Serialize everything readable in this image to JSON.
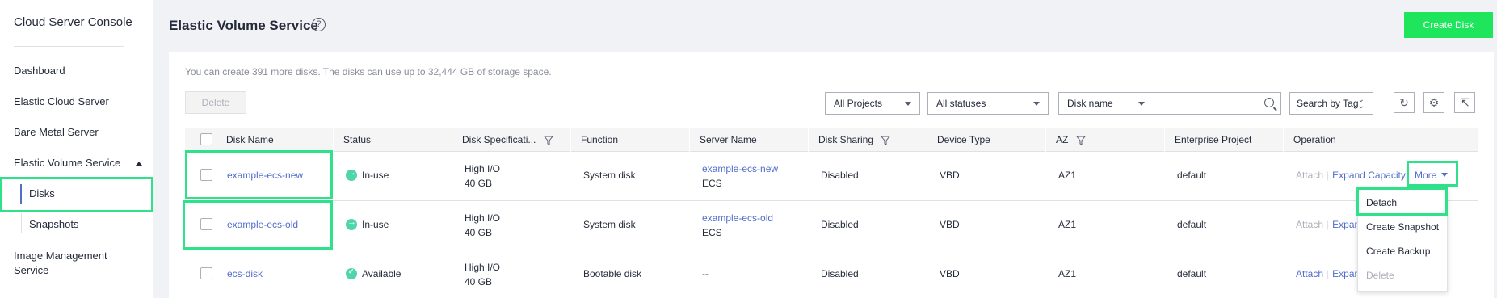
{
  "sidebar": {
    "title": "Cloud Server Console",
    "items": [
      {
        "label": "Dashboard"
      },
      {
        "label": "Elastic Cloud Server"
      },
      {
        "label": "Bare Metal Server"
      },
      {
        "label": "Elastic Volume Service"
      },
      {
        "label": "Disks"
      },
      {
        "label": "Snapshots"
      },
      {
        "label": "Image Management Service"
      }
    ]
  },
  "header": {
    "title": "Elastic Volume Service",
    "help_icon": "?",
    "create_label": "Create Disk"
  },
  "toolbar": {
    "quota_text": "You can create 391 more disks. The disks can use up to 32,444 GB of storage space.",
    "delete_label": "Delete",
    "project_select": "All Projects",
    "status_select": "All statuses",
    "search_field_select": "Disk name",
    "search_placeholder": "",
    "tag_label": "Search by Tag"
  },
  "table": {
    "headers": {
      "disk_name": "Disk Name",
      "status": "Status",
      "spec": "Disk Specificati...",
      "function": "Function",
      "server": "Server Name",
      "sharing": "Disk Sharing",
      "device": "Device Type",
      "az": "AZ",
      "project": "Enterprise Project",
      "operation": "Operation"
    },
    "rows": [
      {
        "name": "example-ecs-new",
        "status": "In-use",
        "spec_type": "High I/O",
        "spec_size": "40 GB",
        "function": "System disk",
        "server_name": "example-ecs-new",
        "server_type": "ECS",
        "sharing": "Disabled",
        "device": "VBD",
        "az": "AZ1",
        "project": "default",
        "op_attach": "Attach",
        "op_expand": "Expand Capacity",
        "op_more": "More"
      },
      {
        "name": "example-ecs-old",
        "status": "In-use",
        "spec_type": "High I/O",
        "spec_size": "40 GB",
        "function": "System disk",
        "server_name": "example-ecs-old",
        "server_type": "ECS",
        "sharing": "Disabled",
        "device": "VBD",
        "az": "AZ1",
        "project": "default",
        "op_attach": "Attach",
        "op_expand": "Expan"
      },
      {
        "name": "ecs-disk",
        "status": "Available",
        "spec_type": "High I/O",
        "spec_size": "40 GB",
        "function": "Bootable disk",
        "server_name": "--",
        "sharing": "Disabled",
        "device": "VBD",
        "az": "AZ1",
        "project": "default",
        "op_attach": "Attach",
        "op_expand": "Expan"
      }
    ]
  },
  "more_menu": {
    "items": [
      "Detach",
      "Create Snapshot",
      "Create Backup",
      "Delete"
    ]
  },
  "colors": {
    "accent": "#1ee55c",
    "link": "#526ecc",
    "highlight": "#2fe28a",
    "status_ok": "#50d4ab"
  }
}
